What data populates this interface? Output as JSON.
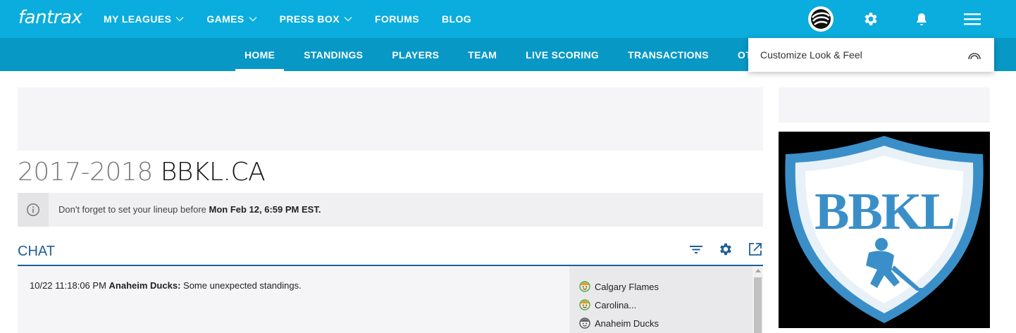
{
  "brand": {
    "name": "fantrax"
  },
  "top_nav": [
    {
      "label": "MY LEAGUES",
      "has_dropdown": true
    },
    {
      "label": "GAMES",
      "has_dropdown": true
    },
    {
      "label": "PRESS BOX",
      "has_dropdown": true
    },
    {
      "label": "FORUMS",
      "has_dropdown": false
    },
    {
      "label": "BLOG",
      "has_dropdown": false
    }
  ],
  "top_icons": [
    "team-avatar-icon",
    "gear-icon",
    "bell-icon",
    "hamburger-menu-icon"
  ],
  "sub_nav": [
    {
      "label": "HOME",
      "active": true
    },
    {
      "label": "STANDINGS",
      "active": false
    },
    {
      "label": "PLAYERS",
      "active": false
    },
    {
      "label": "TEAM",
      "active": false
    },
    {
      "label": "LIVE SCORING",
      "active": false
    },
    {
      "label": "TRANSACTIONS",
      "active": false
    },
    {
      "label": "OTHER",
      "active": false
    }
  ],
  "dropdown": {
    "item_label": "Customize Look & Feel"
  },
  "page_title": {
    "season": "2017-2018",
    "league": "BBKL.CA"
  },
  "notice": {
    "text": "Don't forget to set your lineup before",
    "deadline": "Mon Feb 12, 6:59 PM EST."
  },
  "chat": {
    "title": "CHAT",
    "messages": [
      {
        "time": "10/22 11:18:06 PM",
        "author": "Anaheim Ducks:",
        "text": "Some unexpected standings."
      }
    ],
    "users": [
      {
        "name": "Calgary Flames",
        "status": "online"
      },
      {
        "name": "Carolina...",
        "status": "online"
      },
      {
        "name": "Anaheim Ducks",
        "status": "offline"
      }
    ]
  },
  "league_logo": {
    "text": "BBKL"
  },
  "colors": {
    "topbar": "#0aaddd",
    "subbar": "#0798c6",
    "chat_accent": "#1f5f95",
    "logo_blue": "#3a8fc8"
  }
}
